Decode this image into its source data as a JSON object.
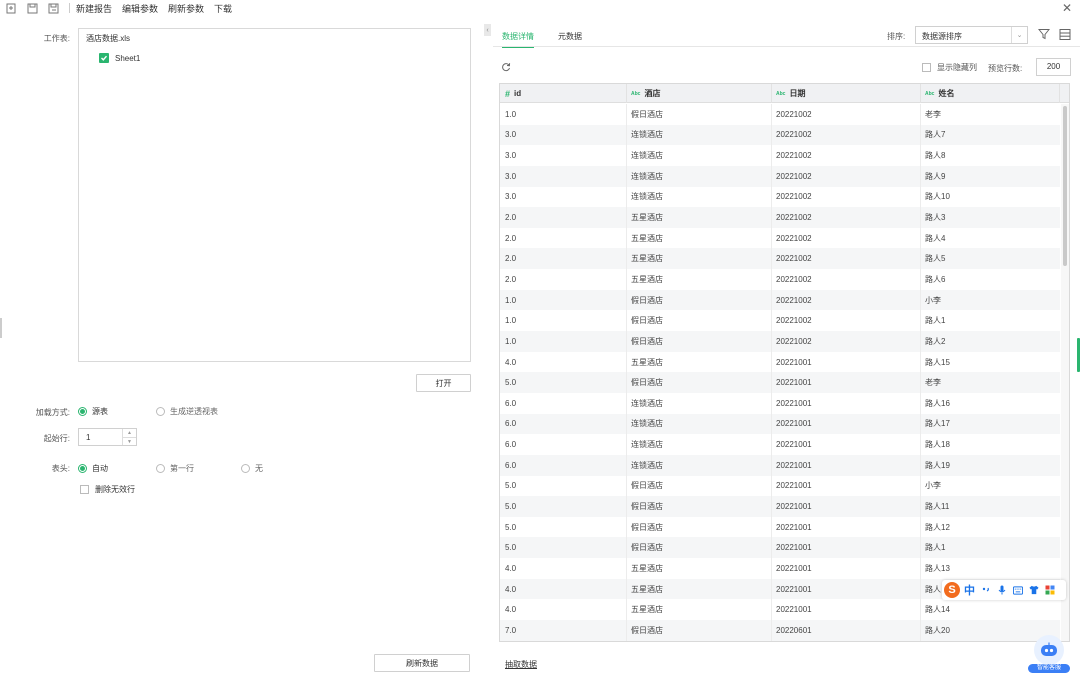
{
  "toolbar": {
    "items": [
      "新建报告",
      "编辑参数",
      "刷新参数",
      "下载"
    ]
  },
  "left": {
    "worksheet_label": "工作表:",
    "file_name": "酒店数据.xls",
    "sheet_name": "Sheet1",
    "open_button": "打开",
    "load_mode_label": "加载方式:",
    "load_mode_options": [
      "源表",
      "生成逆透视表"
    ],
    "start_row_label": "起始行:",
    "start_row_value": "1",
    "header_label": "表头:",
    "header_options": [
      "自动",
      "第一行",
      "无"
    ],
    "delete_invalid_rows": "删除无效行",
    "refresh_button": "刷新数据"
  },
  "right": {
    "tabs": [
      "数据详情",
      "元数据"
    ],
    "sort_label": "排序:",
    "sort_value": "数据源排序",
    "show_hidden_label": "显示隐藏列",
    "preview_rows_label": "预览行数:",
    "preview_rows_value": "200",
    "extract_link": "抽取数据",
    "columns": [
      {
        "type": "#",
        "name": "id"
      },
      {
        "type": "Abc",
        "name": "酒店"
      },
      {
        "type": "Abc",
        "name": "日期"
      },
      {
        "type": "Abc",
        "name": "姓名"
      }
    ],
    "rows": [
      [
        "1.0",
        "假日酒店",
        "20221002",
        "老李"
      ],
      [
        "3.0",
        "连锁酒店",
        "20221002",
        "路人7"
      ],
      [
        "3.0",
        "连锁酒店",
        "20221002",
        "路人8"
      ],
      [
        "3.0",
        "连锁酒店",
        "20221002",
        "路人9"
      ],
      [
        "3.0",
        "连锁酒店",
        "20221002",
        "路人10"
      ],
      [
        "2.0",
        "五星酒店",
        "20221002",
        "路人3"
      ],
      [
        "2.0",
        "五星酒店",
        "20221002",
        "路人4"
      ],
      [
        "2.0",
        "五星酒店",
        "20221002",
        "路人5"
      ],
      [
        "2.0",
        "五星酒店",
        "20221002",
        "路人6"
      ],
      [
        "1.0",
        "假日酒店",
        "20221002",
        "小李"
      ],
      [
        "1.0",
        "假日酒店",
        "20221002",
        "路人1"
      ],
      [
        "1.0",
        "假日酒店",
        "20221002",
        "路人2"
      ],
      [
        "4.0",
        "五星酒店",
        "20221001",
        "路人15"
      ],
      [
        "5.0",
        "假日酒店",
        "20221001",
        "老李"
      ],
      [
        "6.0",
        "连锁酒店",
        "20221001",
        "路人16"
      ],
      [
        "6.0",
        "连锁酒店",
        "20221001",
        "路人17"
      ],
      [
        "6.0",
        "连锁酒店",
        "20221001",
        "路人18"
      ],
      [
        "6.0",
        "连锁酒店",
        "20221001",
        "路人19"
      ],
      [
        "5.0",
        "假日酒店",
        "20221001",
        "小李"
      ],
      [
        "5.0",
        "假日酒店",
        "20221001",
        "路人11"
      ],
      [
        "5.0",
        "假日酒店",
        "20221001",
        "路人12"
      ],
      [
        "5.0",
        "假日酒店",
        "20221001",
        "路人1"
      ],
      [
        "4.0",
        "五星酒店",
        "20221001",
        "路人13"
      ],
      [
        "4.0",
        "五星酒店",
        "20221001",
        "路人"
      ],
      [
        "4.0",
        "五星酒店",
        "20221001",
        "路人14"
      ],
      [
        "7.0",
        "假日酒店",
        "20220601",
        "路人20"
      ]
    ]
  },
  "ime": {
    "lang": "中"
  },
  "assistant": {
    "label": "智能客服"
  },
  "colors": {
    "accent": "#2ab56f",
    "assistant": "#3b7ff5",
    "ime_logo": "#f26b1d"
  }
}
